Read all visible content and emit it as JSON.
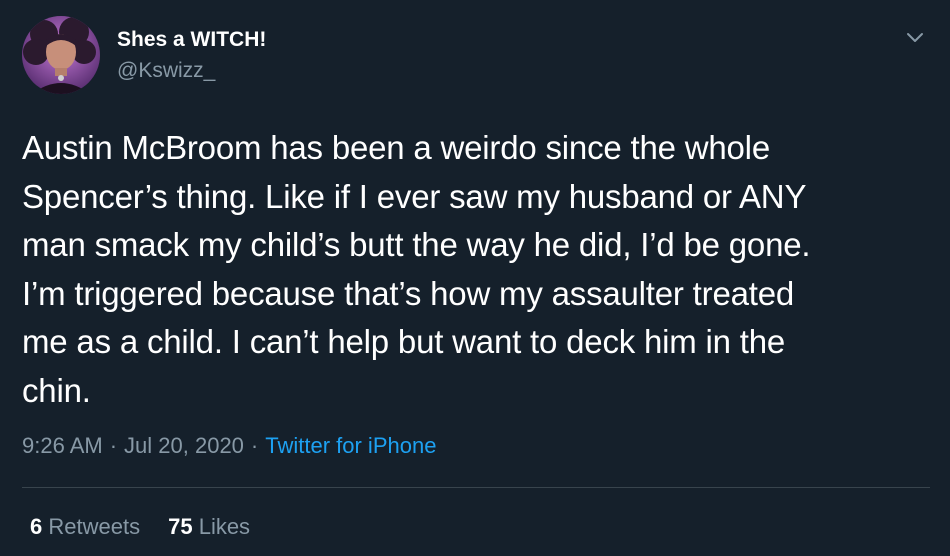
{
  "tweet": {
    "display_name": "Shes a WITCH!",
    "handle": "@Kswizz_",
    "text": "Austin McBroom has been a weirdo since the whole\nSpencer’s thing. Like if I ever saw my husband or ANY\nman smack my child’s butt the way he did, I’d be gone.\nI’m triggered because that’s how my assaulter treated\nme as a child. I can’t help but want to deck him in the\nchin.",
    "time": "9:26 AM",
    "separator": "·",
    "date": "Jul 20, 2020",
    "source": "Twitter for iPhone",
    "retweets_count": "6",
    "retweets_label": "Retweets",
    "likes_count": "75",
    "likes_label": "Likes"
  },
  "icons": {
    "avatar": "avatar",
    "menu": "chevron-down-icon"
  },
  "colors": {
    "background": "#15202b",
    "primary_text": "#ffffff",
    "secondary_text": "#8899a6",
    "link": "#1da1f2",
    "divider": "#38444d"
  }
}
